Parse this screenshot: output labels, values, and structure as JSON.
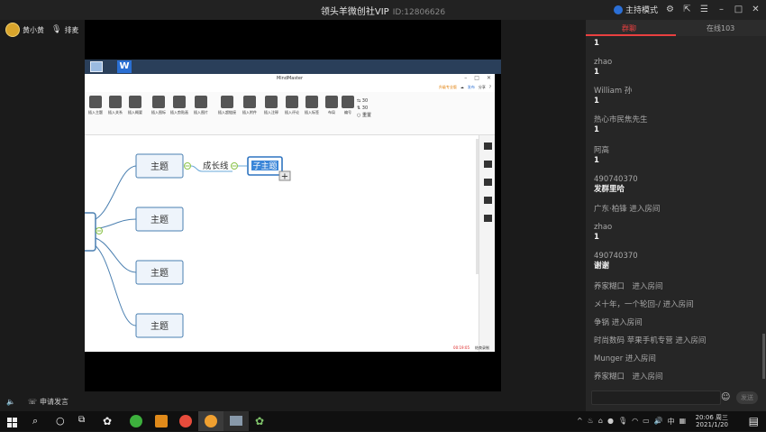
{
  "titlebar": {
    "title": "领头羊微创社VIP",
    "room_id": "ID:12806626",
    "host_mode": "主持模式"
  },
  "userbar": {
    "user_name": "黄小黄",
    "mic_label": "排麦"
  },
  "mindmaster": {
    "window_title": "MindMaster",
    "menu_right": {
      "upgrade": "升级专业版",
      "share": "发布",
      "extra": "分享"
    },
    "toolbar": [
      {
        "label": "插入主题"
      },
      {
        "label": "插入关系"
      },
      {
        "label": "插入概要"
      },
      {
        "label": "插入图标"
      },
      {
        "label": "插入剪贴画"
      },
      {
        "label": "插入图片"
      },
      {
        "label": "插入超链接"
      },
      {
        "label": "插入附件"
      },
      {
        "label": "插入注释"
      },
      {
        "label": "插入评论"
      },
      {
        "label": "插入标签"
      },
      {
        "label": "布局"
      },
      {
        "label": "编号"
      }
    ],
    "spin1": "30",
    "spin2": "30",
    "reset": "重置",
    "nodes": {
      "topic1": "主题",
      "topic2": "主题",
      "topic3": "主题",
      "topic4": "主题",
      "grow_line": "成长线",
      "subtopic": "子主题"
    },
    "status": {
      "time": "00:19:05",
      "record": "结束录制"
    }
  },
  "chat": {
    "tab_active": "群聊",
    "tab_inactive": "在线103",
    "messages": [
      {
        "name": "",
        "text": "1"
      },
      {
        "name": "zhao",
        "text": "1"
      },
      {
        "name": "William 孙",
        "text": "1"
      },
      {
        "name": "热心市民焦先生",
        "text": "1"
      },
      {
        "name": "阿高",
        "text": "1"
      },
      {
        "name": "490740370",
        "text": "发群里哈"
      },
      {
        "system": "广东·柏锋 进入房间"
      },
      {
        "name": "zhao",
        "text": "1"
      },
      {
        "name": "490740370",
        "text": "谢谢"
      },
      {
        "system": "养家糊口　进入房间"
      },
      {
        "system": "メ十年，一个轮回-/ 进入房间"
      },
      {
        "system": "争锅 进入房间"
      },
      {
        "system": "时尚数码  苹果手机专营 进入房间"
      },
      {
        "system": "Munger 进入房间"
      },
      {
        "system": "养家糊口　进入房间"
      }
    ],
    "send_label": "发送"
  },
  "bottom_left": {
    "apply_speak": "申请发言"
  },
  "taskbar": {
    "time": "20:06 周三",
    "date": "2021/1/20",
    "ime": "中"
  }
}
